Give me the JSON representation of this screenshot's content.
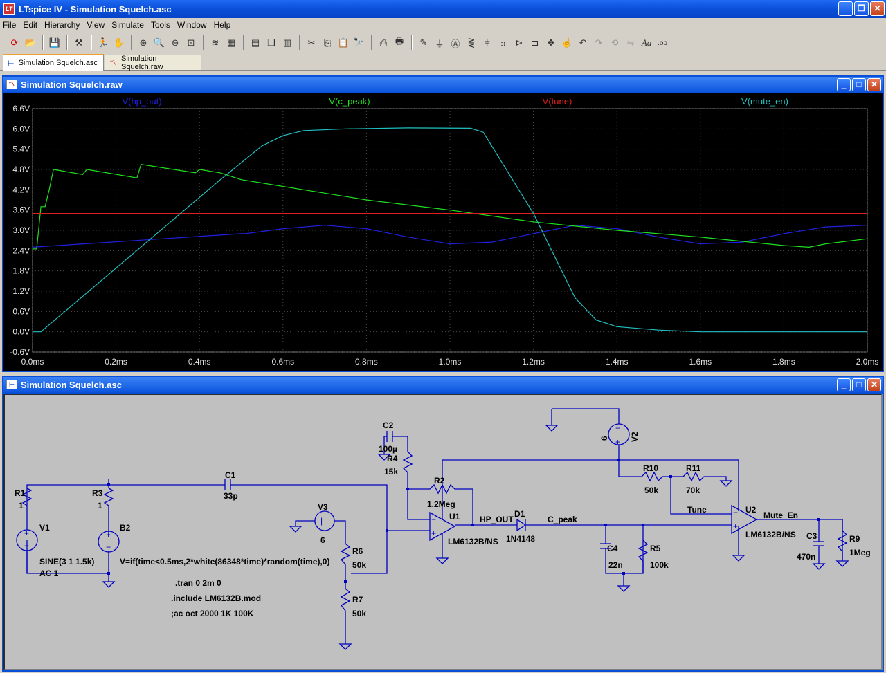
{
  "app": {
    "title": "LTspice IV - Simulation Squelch.asc",
    "menu": [
      "File",
      "Edit",
      "Hierarchy",
      "View",
      "Simulate",
      "Tools",
      "Window",
      "Help"
    ],
    "toolbar_icons": [
      "open-schematic-icon",
      "open-file-icon",
      "save-icon",
      "control-panel-icon",
      "run-icon",
      "halt-icon",
      "zoom-in-icon",
      "zoom-out-icon",
      "zoom-fit-icon",
      "zoom-area-icon",
      "autorange-icon",
      "grid-icon",
      "tile-horizontal-icon",
      "cascade-icon",
      "tile-vertical-icon",
      "cut-icon",
      "copy-icon",
      "paste-icon",
      "find-icon",
      "print-setup-icon",
      "print-icon",
      "draw-wire-icon",
      "ground-icon",
      "label-net-icon",
      "resistor-icon",
      "capacitor-icon",
      "inductor-icon",
      "diode-icon",
      "component-icon",
      "move-icon",
      "drag-icon",
      "undo-icon",
      "redo-icon",
      "rotate-icon",
      "mirror-icon",
      "text-icon",
      "spice-directive-icon"
    ]
  },
  "tabs": [
    {
      "label": "Simulation Squelch.asc",
      "active": true,
      "icon": "schematic-icon"
    },
    {
      "label": "Simulation Squelch.raw",
      "active": false,
      "icon": "waveform-icon"
    }
  ],
  "waveform_window": {
    "title": "Simulation Squelch.raw",
    "chart_data": {
      "type": "line",
      "xlabel": "",
      "ylabel": "",
      "xlim": [
        0,
        2.0
      ],
      "ylim": [
        -0.6,
        6.6
      ],
      "x_ticks": [
        "0.0ms",
        "0.2ms",
        "0.4ms",
        "0.6ms",
        "0.8ms",
        "1.0ms",
        "1.2ms",
        "1.4ms",
        "1.6ms",
        "1.8ms",
        "2.0ms"
      ],
      "y_ticks": [
        "6.6V",
        "6.0V",
        "5.4V",
        "4.8V",
        "4.2V",
        "3.6V",
        "3.0V",
        "2.4V",
        "1.8V",
        "1.2V",
        "0.6V",
        "0.0V",
        "-0.6V"
      ],
      "grid": true,
      "series": [
        {
          "name": "V(hp_out)",
          "color": "#2020e0",
          "x": [
            0,
            0.5,
            0.51,
            0.6,
            0.7,
            0.8,
            0.9,
            1.0,
            1.1,
            1.2,
            1.3,
            1.4,
            1.5,
            1.6,
            1.7,
            1.8,
            1.9,
            2.0
          ],
          "y": [
            2.5,
            2.9,
            2.9,
            3.05,
            3.15,
            3.05,
            2.8,
            2.6,
            2.65,
            2.9,
            3.15,
            3.05,
            2.8,
            2.6,
            2.65,
            2.9,
            3.1,
            3.15
          ]
        },
        {
          "name": "V(c_peak)",
          "color": "#20e020",
          "x": [
            0,
            0.01,
            0.02,
            0.03,
            0.04,
            0.05,
            0.12,
            0.13,
            0.25,
            0.26,
            0.39,
            0.4,
            0.45,
            0.5,
            0.8,
            1.0,
            1.2,
            1.4,
            1.6,
            1.8,
            1.86,
            1.9,
            2.0
          ],
          "y": [
            2.45,
            2.45,
            3.7,
            3.7,
            4.2,
            4.8,
            4.65,
            4.8,
            4.55,
            4.95,
            4.7,
            4.8,
            4.7,
            4.5,
            3.9,
            3.6,
            3.25,
            3.0,
            2.8,
            2.55,
            2.5,
            2.6,
            2.75
          ]
        },
        {
          "name": "V(tune)",
          "color": "#e02020",
          "x": [
            0,
            2.0
          ],
          "y": [
            3.5,
            3.5
          ]
        },
        {
          "name": "V(mute_en)",
          "color": "#20c0c0",
          "x": [
            0,
            0.02,
            0.45,
            0.55,
            0.6,
            0.65,
            0.75,
            0.9,
            1.05,
            1.08,
            1.2,
            1.3,
            1.35,
            1.4,
            1.5,
            1.6,
            2.0
          ],
          "y": [
            0,
            0,
            4.5,
            5.5,
            5.8,
            5.95,
            6.0,
            6.03,
            6.02,
            5.9,
            3.5,
            1.0,
            0.35,
            0.15,
            0.05,
            0.0,
            0.0
          ]
        }
      ]
    }
  },
  "schematic_window": {
    "title": "Simulation Squelch.asc",
    "labels": {
      "r1": "R1",
      "r1v": "1",
      "r3": "R3",
      "r3v": "1",
      "v1": "V1",
      "b2": "B2",
      "v1_sine": "SINE(3 1 1.5k)",
      "v1_ac": "AC 1",
      "b2_expr": "V=if(time<0.5ms,2*white(86348*time)*random(time),0)",
      "c1": "C1",
      "c1v": "33p",
      "c2": "C2",
      "c2v": "100µ",
      "r4": "R4",
      "r4v": "15k",
      "r2": "R2",
      "r2v": "1.2Meg",
      "u1": "U1",
      "u1v": "LM6132B/NS",
      "v3": "V3",
      "v3v": "6",
      "r6": "R6",
      "r6v": "50k",
      "r7": "R7",
      "r7v": "50k",
      "hp_out": "HP_OUT",
      "d1": "D1",
      "d1v": "1N4148",
      "c_peak": "C_peak",
      "c4": "C4",
      "c4v": "22n",
      "r5": "R5",
      "r5v": "100k",
      "v2": "V2",
      "v2v": "6",
      "r10": "R10",
      "r10v": "50k",
      "r11": "R11",
      "r11v": "70k",
      "tune": "Tune",
      "u2": "U2",
      "u2v": "LM6132B/NS",
      "mute_en": "Mute_En",
      "c3": "C3",
      "c3v": "470n",
      "r9": "R9",
      "r9v": "1Meg",
      "d_tran": ".tran 0 2m 0",
      "d_include": ".include LM6132B.mod",
      "d_ac": ";ac oct 2000 1K 100K"
    }
  }
}
